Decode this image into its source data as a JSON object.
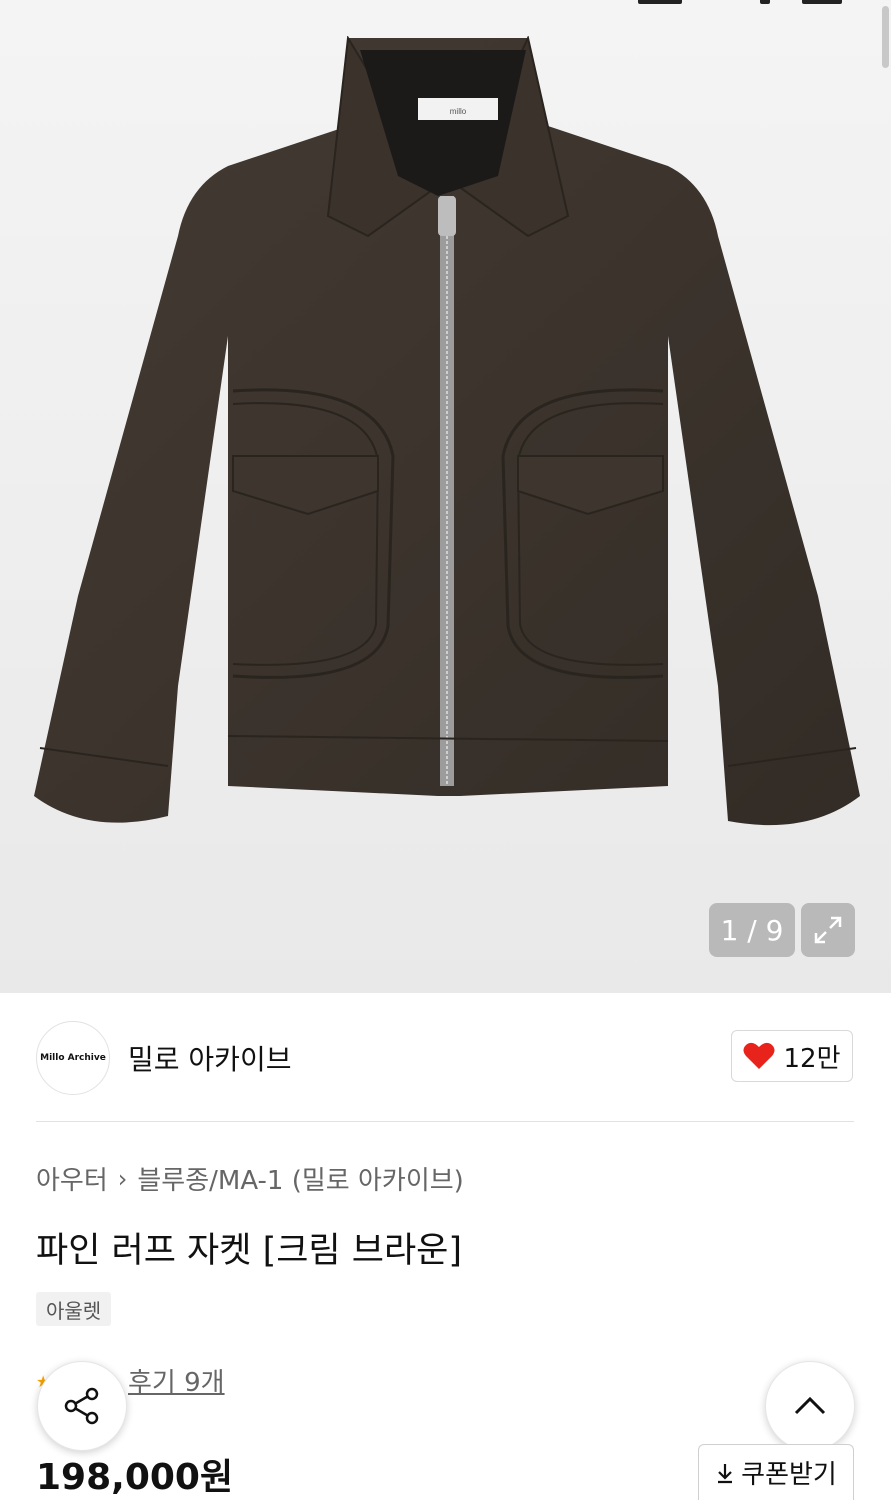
{
  "gallery": {
    "counter": "1 / 9",
    "product_label_text": "millo",
    "icons": {
      "expand": "expand-icon"
    }
  },
  "brand": {
    "logo_text": "Millo Archive",
    "name": "밀로 아카이브",
    "like_count": "12만",
    "like_color": "#e8231c"
  },
  "breadcrumb": {
    "category": "아우터",
    "subcategory": "블루종/MA-1 (밀로 아카이브)"
  },
  "product": {
    "title": "파인 러프 자켓 [크림 브라운]",
    "tag": "아울렛",
    "review_text": "후기 9개",
    "price": "198,000원"
  },
  "actions": {
    "coupon_label": "쿠폰받기"
  }
}
